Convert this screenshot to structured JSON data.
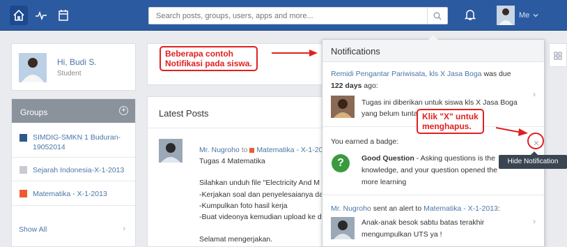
{
  "topbar": {
    "search_placeholder": "Search posts, groups, users, apps and more...",
    "me_label": "Me"
  },
  "profile": {
    "greeting": "Hi, Budi S.",
    "role": "Student"
  },
  "groups": {
    "title": "Groups",
    "items": [
      {
        "name": "SIMDIG-SMKN 1 Buduran-19052014",
        "color": "#2c5a8c"
      },
      {
        "name": "Sejarah Indonesia-X-1-2013",
        "color": "#c8ccd2"
      },
      {
        "name": "Matematika - X-1-2013",
        "color": "#ee5a2f"
      }
    ],
    "show_all": "Show All"
  },
  "posts": {
    "title": "Latest Posts",
    "post": {
      "author": "Mr. Nugroho",
      "to": "to",
      "group": "Matematika - X-1-20",
      "title": "Tugas 4 Matematika",
      "lines": [
        "Silahkan unduh file \"Electricity And M",
        "-Kerjakan soal dan penyelesaianya da",
        "-Kumpulkan foto hasil kerja",
        "-Buat videonya kemudian upload ke d",
        "Selamat mengerjakan."
      ]
    }
  },
  "notifications": {
    "title": "Notifications",
    "items": [
      {
        "line1_link": "Remidi Pengantar Pariwisata, kls X Jasa Boga",
        "line1_rest": " was due",
        "line2_bold": "122 days",
        "line2_rest": " ago:",
        "body1": "Tugas ini diberikan untuk siswa kls X Jasa Boga",
        "body2": "yang belum tunta"
      },
      {
        "header": "You earned a badge:",
        "badge_name": "Good Question",
        "body1": " - Asking questions is the",
        "body2": "knowledge, and your question opened the",
        "body3": "more learning",
        "badge_glyph": "?"
      },
      {
        "author": "Mr. Nugroho",
        "middle": " sent an alert to ",
        "group": "Matematika - X-1-2013",
        "colon": ":",
        "body1": "Anak-anak besok sabtu batas terakhir",
        "body2": "mengumpulkan UTS ya !"
      }
    ]
  },
  "tooltip": "Hide Notification",
  "annotations": {
    "callout1_line1": "Beberapa contoh",
    "callout1_line2": "Notifikasi pada siswa.",
    "callout2_line1": "Klik \"X\" untuk",
    "callout2_line2": "menghapus.",
    "accent": "#e02020"
  },
  "colors": {
    "topbar": "#2c5aa0",
    "link": "#4a76a8"
  }
}
